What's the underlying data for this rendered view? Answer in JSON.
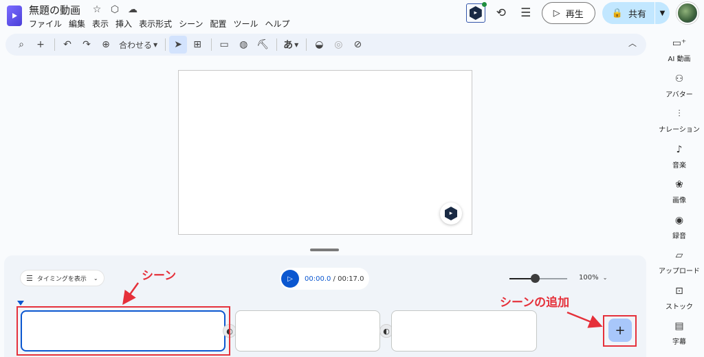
{
  "header": {
    "title": "無題の動画",
    "menu": [
      "ファイル",
      "編集",
      "表示",
      "挿入",
      "表示形式",
      "シーン",
      "配置",
      "ツール",
      "ヘルプ"
    ],
    "play_label": "再生",
    "share_label": "共有"
  },
  "toolbar": {
    "zoom_label": "合わせる",
    "text_style_label": "あ"
  },
  "timeline": {
    "timing_label": "タイミングを表示",
    "current_time": "00:00.0",
    "separator": " / ",
    "total_time": "00:17.0",
    "zoom_percent": "100%",
    "zoom_level": 0.45,
    "scenes": [
      {
        "selected": true
      },
      {
        "selected": false
      },
      {
        "selected": false
      }
    ]
  },
  "annotations": {
    "scene_label": "シーン",
    "add_scene_label": "シーンの追加",
    "color": "#e5303a"
  },
  "side_panel": {
    "items": [
      {
        "icon": "ai-video-icon",
        "label": "AI 動画"
      },
      {
        "icon": "avatar-icon",
        "label": "アバター"
      },
      {
        "icon": "narration-icon",
        "label": "ナレーション"
      },
      {
        "icon": "music-icon",
        "label": "音楽"
      },
      {
        "icon": "image-icon",
        "label": "画像"
      },
      {
        "icon": "record-icon",
        "label": "録音"
      },
      {
        "icon": "upload-icon",
        "label": "アップロード"
      },
      {
        "icon": "stock-icon",
        "label": "ストック"
      },
      {
        "icon": "caption-icon",
        "label": "字幕"
      }
    ]
  },
  "colors": {
    "accent": "#0b57d0",
    "share_bg": "#c2e7ff",
    "toolbar_bg": "#edf2fa",
    "annotation": "#e5303a"
  }
}
